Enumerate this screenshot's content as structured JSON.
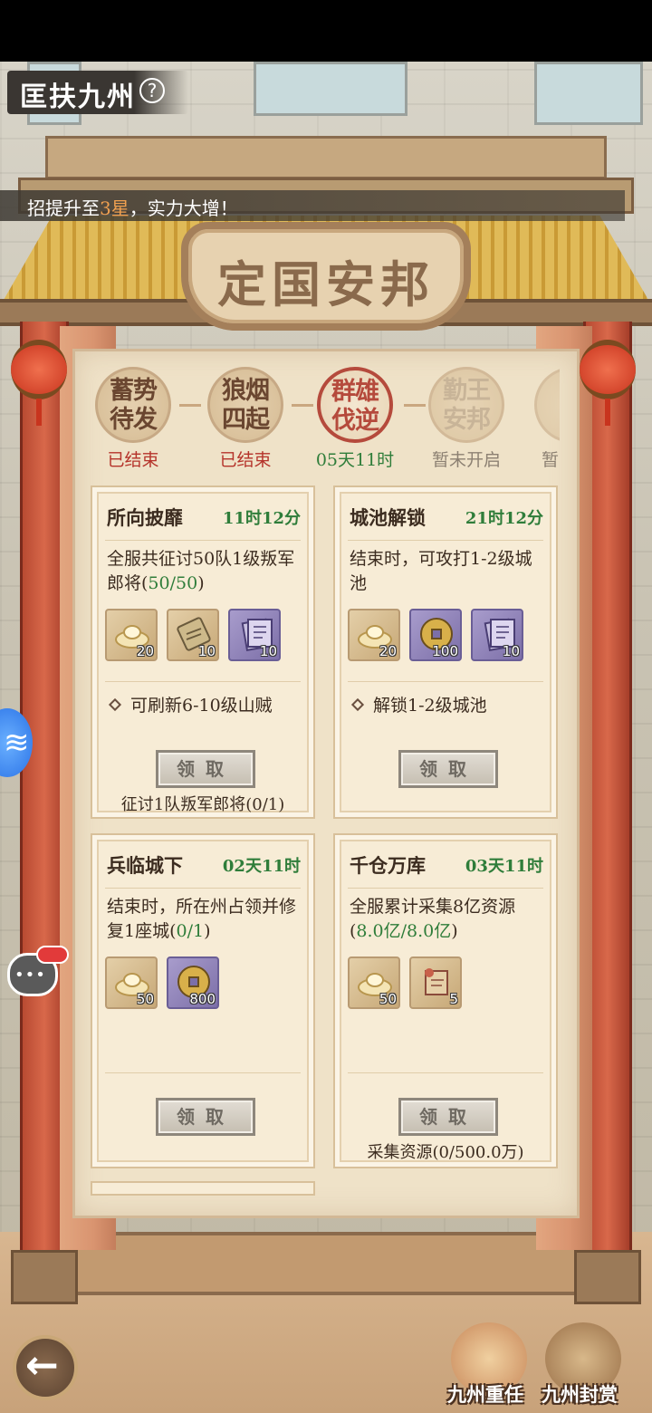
{
  "header": {
    "title": "匡扶九州",
    "help_icon": "?"
  },
  "marquee": {
    "prefix": "招提升至",
    "highlight": "3星",
    "suffix": "，实力大增！"
  },
  "plaque": {
    "text": "定国安邦"
  },
  "stages": [
    {
      "name": "蓄势待发",
      "status": "已结束",
      "state": "ended"
    },
    {
      "name": "狼烟四起",
      "status": "已结束",
      "state": "ended"
    },
    {
      "name": "群雄伐逆",
      "status": "05天11时",
      "state": "running"
    },
    {
      "name": "勤王安邦",
      "status": "暂未开启",
      "state": "locked"
    },
    {
      "name": "",
      "status": "暂",
      "state": "locked"
    }
  ],
  "cards": [
    {
      "title": "所向披靡",
      "timer": "11时12分",
      "desc": "全服共征讨50队1级叛军郎将(",
      "progress": "50/50",
      "desc_end": ")",
      "rewards": [
        {
          "icon": "gold-ingot-icon",
          "count": "20",
          "style": "gold"
        },
        {
          "icon": "token-icon",
          "count": "10",
          "style": "gold"
        },
        {
          "icon": "book-icon",
          "count": "10",
          "style": "purple"
        }
      ],
      "unlock": "可刷新6-10级山贼",
      "button": "领取",
      "condition": "征讨1队叛军郎将(0/1)"
    },
    {
      "title": "城池解锁",
      "timer": "21时12分",
      "desc": "结束时，可攻打1-2级城池",
      "progress": "",
      "desc_end": "",
      "rewards": [
        {
          "icon": "gold-ingot-icon",
          "count": "20",
          "style": "gold"
        },
        {
          "icon": "coin-icon",
          "count": "100",
          "style": "purple"
        },
        {
          "icon": "book-icon",
          "count": "10",
          "style": "purple"
        }
      ],
      "unlock": "解锁1-2级城池",
      "button": "领取",
      "condition": ""
    },
    {
      "title": "兵临城下",
      "timer": "02天11时",
      "desc": "结束时，所在州占领并修复1座城(",
      "progress": "0/1",
      "desc_end": ")",
      "rewards": [
        {
          "icon": "gold-ingot-icon",
          "count": "50",
          "style": "gold"
        },
        {
          "icon": "coin-icon",
          "count": "800",
          "style": "purple"
        }
      ],
      "unlock": "",
      "button": "领取",
      "condition": ""
    },
    {
      "title": "千仓万库",
      "timer": "03天11时",
      "desc": "全服累计采集8亿资源(",
      "progress": "8.0亿/8.0亿",
      "desc_end": ")",
      "rewards": [
        {
          "icon": "gold-ingot-icon",
          "count": "50",
          "style": "gold"
        },
        {
          "icon": "scroll-icon",
          "count": "5",
          "style": "gold"
        }
      ],
      "unlock": "",
      "button": "领取",
      "condition": "采集资源(0/500.0万)"
    }
  ],
  "bottom": {
    "left_label": "九州重任",
    "right_label": "九州封赏"
  }
}
